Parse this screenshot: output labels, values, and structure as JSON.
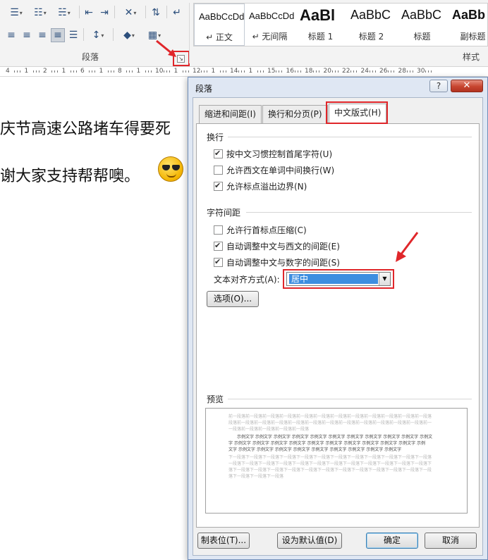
{
  "ribbon": {
    "paragraph_group_label": "段落",
    "styles_group_label": "样式",
    "launcher_glyph": "↘",
    "styles": [
      {
        "sample": "AaBbCcDd",
        "name": "↵ 正文"
      },
      {
        "sample": "AaBbCcDd",
        "name": "↵ 无间隔"
      },
      {
        "sample": "AaBl",
        "name": "标题 1"
      },
      {
        "sample": "AaBbC",
        "name": "标题 2"
      },
      {
        "sample": "AaBbC",
        "name": "标题"
      },
      {
        "sample": "AaBb",
        "name": "副标题"
      }
    ]
  },
  "ruler": {
    "labels": [
      "4",
      "1",
      "2",
      "1",
      "6",
      "1",
      "8",
      "1",
      "10",
      "1",
      "12",
      "1",
      "14",
      "1",
      "15",
      "16",
      "18",
      "20",
      "22",
      "24",
      "26",
      "28",
      "30"
    ]
  },
  "document": {
    "line1": "庆节高速公路堵车得要死",
    "line2": "谢大家支持帮帮噢。"
  },
  "dialog": {
    "title": "段落",
    "help_label": "?",
    "close_label": "✕",
    "tabs": [
      "缩进和间距(I)",
      "换行和分页(P)",
      "中文版式(H)"
    ],
    "section_wrap": "换行",
    "wrap_options": [
      {
        "label": "按中文习惯控制首尾字符(U)",
        "checked": true
      },
      {
        "label": "允许西文在单词中间换行(W)",
        "checked": false
      },
      {
        "label": "允许标点溢出边界(N)",
        "checked": true
      }
    ],
    "section_spacing": "字符间距",
    "spacing_options": [
      {
        "label": "允许行首标点压缩(C)",
        "checked": false
      },
      {
        "label": "自动调整中文与西文的间距(E)",
        "checked": true
      },
      {
        "label": "自动调整中文与数字的间距(S)",
        "checked": true
      }
    ],
    "align_label": "文本对齐方式(A):",
    "align_value": "居中",
    "options_button": "选项(O)...",
    "preview_label": "预览",
    "preview_lines": {
      "before": [
        "前一段落前一段落前一段落前一段落前一段落前一段落前一段落前一段落前一段落前一段落前一段落前一段落",
        "段落前一段落前一段落前一段落前一段落前一段落前一段落前一段落前一段落前一段落前一段落前一段落前一",
        "一段落前一段落前一段落前一段落前一段落"
      ],
      "sample": [
        "示例文字 示例文字 示例文字 示例文字 示例文字 示例文字 示例文字 示例文字 示例文字 示例文字 示例文",
        "字 示例文字 示例文字 示例文字 示例文字 示例文字 示例文字 示例文字 示例文字 示例文字 示例文字 示例",
        "文字 示例文字 示例文字 示例文字 示例文字 示例文字 示例文字 示例文字 示例文字 示例文字"
      ],
      "after": [
        "下一段落下一段落下一段落下一段落下一段落下一段落下一段落下一段落下一段落下一段落下一段落下一段落",
        "一段落下一段落下一段落下一段落下一段落下一段落下一段落下一段落下一段落下一段落下一段落下一段落下",
        "落下一段落下一段落下一段落下一段落下一段落下一段落下一段落下一段落下一段落下一段落下一段落下一段",
        "落下一段落下一段落下一段落"
      ]
    },
    "footer": {
      "tabs_button": "制表位(T)...",
      "default_button": "设为默认值(D)",
      "ok_button": "确定",
      "cancel_button": "取消"
    }
  },
  "colors": {
    "highlight_red": "#e0262a",
    "selection_blue": "#3d8ee0",
    "dialog_frame": "#dfe7f3"
  }
}
